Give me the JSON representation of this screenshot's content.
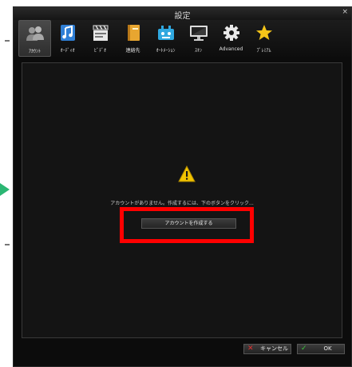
{
  "window": {
    "title": "設定",
    "close_glyph": "×"
  },
  "toolbar": {
    "items": [
      {
        "label": "ｱｶｳﾝﾄ",
        "icon": "account-icon"
      },
      {
        "label": "ｵｰﾃﾞｨｵ",
        "icon": "music-note-icon"
      },
      {
        "label": "ﾋﾞﾃﾞｵ",
        "icon": "clapperboard-icon"
      },
      {
        "label": "連絡先",
        "icon": "contacts-book-icon"
      },
      {
        "label": "ｵｰﾄﾒｰｼｮﾝ",
        "icon": "automation-icon"
      },
      {
        "label": "ｽｷﾝ",
        "icon": "monitor-icon"
      },
      {
        "label": "Advanced",
        "icon": "gear-icon"
      },
      {
        "label": "ﾌﾟﾚﾐｱﾑ",
        "icon": "star-icon"
      }
    ]
  },
  "main": {
    "message": "アカウントがありません。作成するには、下のボタンをクリック...",
    "create_button": "アカウントを作成する"
  },
  "footer": {
    "cancel_label": "キャンセル",
    "ok_label": "OK"
  },
  "colors": {
    "highlight": "#ff0000",
    "arrow": "#2bb673",
    "warning": "#f2c400",
    "star": "#f5c518",
    "cancel_x": "#e03030",
    "ok_check": "#3cc83c"
  }
}
